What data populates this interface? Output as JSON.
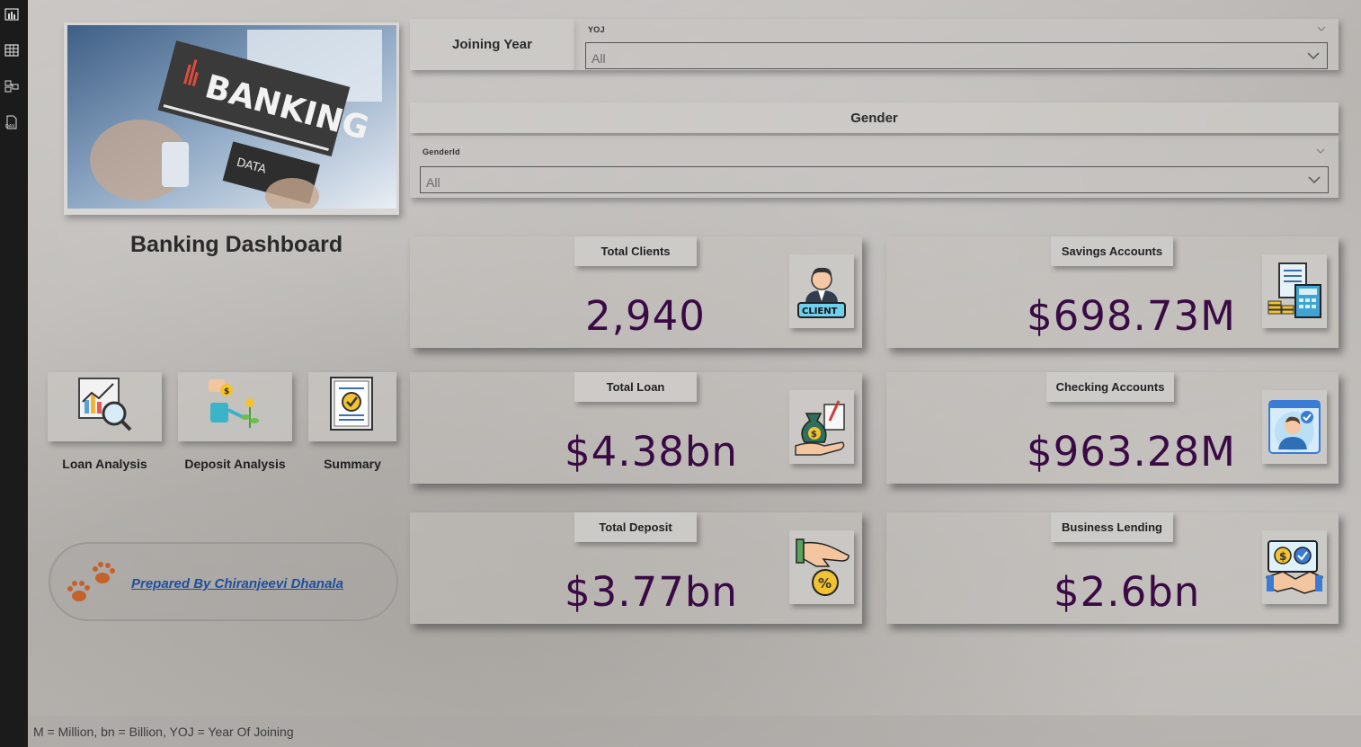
{
  "app": {
    "title": "Banking Dashboard",
    "hero_text": "BANKING",
    "hero_subtext": "DATA",
    "footer_note": "M = Million, bn = Billion, YOJ = Year Of Joining"
  },
  "rail": {
    "icons": [
      "report-view-icon",
      "table-view-icon",
      "model-view-icon",
      "dax-query-icon"
    ]
  },
  "navigation": [
    {
      "label": "Loan Analysis",
      "icon": "loan-chart-icon"
    },
    {
      "label": "Deposit Analysis",
      "icon": "deposit-growth-icon"
    },
    {
      "label": "Summary",
      "icon": "summary-document-icon"
    }
  ],
  "credit": {
    "text": "Prepared By Chiranjeevi Dhanala",
    "icon": "paw-prints-icon"
  },
  "slicers": {
    "joining_year": {
      "title": "Joining Year",
      "field": "YOJ",
      "value": "All"
    },
    "gender": {
      "title": "Gender",
      "field": "GenderId",
      "value": "All"
    }
  },
  "kpis": {
    "total_clients": {
      "label": "Total Clients",
      "value": "2,940",
      "icon": "client-icon"
    },
    "savings_accounts": {
      "label": "Savings Accounts",
      "value": "$698.73M",
      "icon": "savings-ledger-icon"
    },
    "total_loan": {
      "label": "Total Loan",
      "value": "$4.38bn",
      "icon": "loan-bag-icon"
    },
    "checking_accounts": {
      "label": "Checking Accounts",
      "value": "$963.28M",
      "icon": "verified-user-icon"
    },
    "total_deposit": {
      "label": "Total Deposit",
      "value": "$3.77bn",
      "icon": "deposit-coin-icon"
    },
    "business_lending": {
      "label": "Business Lending",
      "value": "$2.6bn",
      "icon": "handshake-icon"
    }
  },
  "colors": {
    "kpi_value": "#3a0a45",
    "link": "#1f4e9e",
    "rail": "#1b1b1b"
  }
}
